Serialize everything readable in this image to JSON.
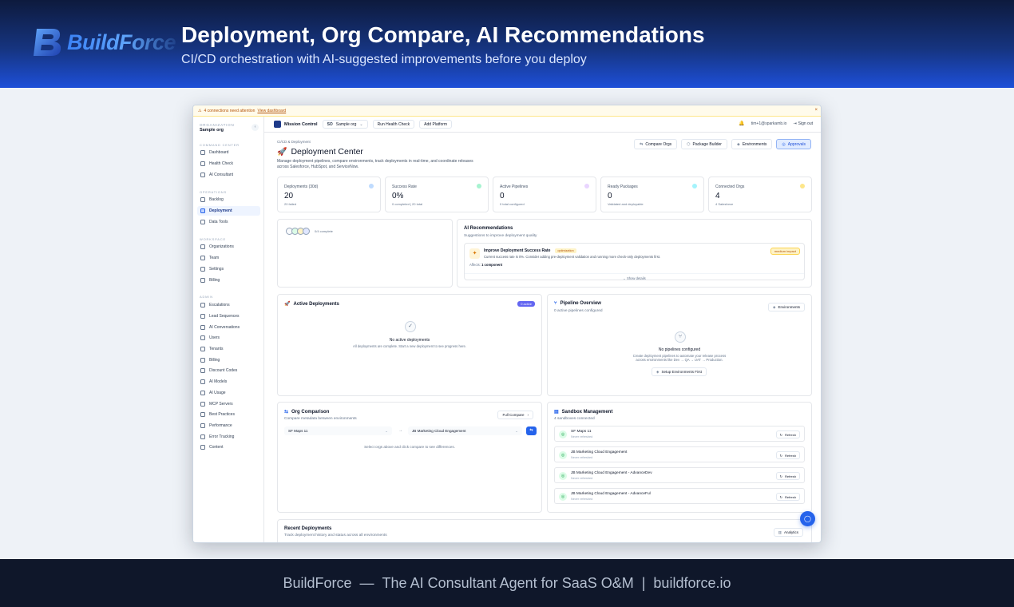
{
  "banner": {
    "logo_text": "BuildForce",
    "title": "Deployment, Org Compare, AI Recommendations",
    "subtitle": "CI/CD orchestration with AI-suggested improvements before you deploy"
  },
  "footer": {
    "brand": "BuildForce",
    "sep1": "—",
    "tagline": "The AI Consultant Agent for SaaS O&M",
    "sep2": "|",
    "site": "buildforce.io"
  },
  "warning": {
    "text": "4 connections need attention",
    "link": "View dashboard",
    "close": "×"
  },
  "sidebar": {
    "org_label": "ORGANIZATION",
    "org_value": "Sample org",
    "org_chevron": "‹",
    "sections": {
      "command": "COMMAND CENTER",
      "operations": "OPERATIONS",
      "workspace": "WORKSPACE",
      "admin": "ADMIN"
    },
    "command_items": [
      "Dashboard",
      "Health Check",
      "AI Consultant"
    ],
    "operations_items": [
      "Backlog",
      "Deployment",
      "Data Tools"
    ],
    "workspace_items": [
      "Organizations",
      "Team",
      "Settings",
      "Billing"
    ],
    "admin_items": [
      "Escalations",
      "Lead Sequences",
      "AI Conversations",
      "Users",
      "Tenants",
      "Billing",
      "Discount Codes",
      "AI Models",
      "AI Usage",
      "MCP Servers",
      "Best Practices",
      "Performance",
      "Error Tracking",
      "Content"
    ]
  },
  "topbar": {
    "title": "Mission Control",
    "org_initials": "SO",
    "org_name": "Sample org",
    "org_chevron": "⌄",
    "btn_health": "Run Health Check",
    "btn_platform": "Add Platform",
    "bell": "🔔",
    "email": "tim+1@sparkamb.io",
    "signout": "Sign out",
    "signout_icon": "⇥"
  },
  "page": {
    "breadcrumb": "CI/CD & Deployment",
    "title": "Deployment Center",
    "title_icon": "🚀",
    "description": "Manage deployment pipelines, compare environments, track deployments in real-time, and coordinate releases across Salesforce, HubSpot, and ServiceNow.",
    "actions": [
      {
        "icon": "⇆",
        "label": "Compare Orgs"
      },
      {
        "icon": "⬡",
        "label": "Package Builder"
      },
      {
        "icon": "◈",
        "label": "Environments"
      },
      {
        "icon": "◎",
        "label": "Approvals"
      }
    ]
  },
  "stats": [
    {
      "label": "Deployments (30d)",
      "value": "20",
      "sub": "20 failed",
      "color": "#3b82f6"
    },
    {
      "label": "Success Rate",
      "value": "0%",
      "sub": "0 completed | 20 total",
      "color": "#10b981"
    },
    {
      "label": "Active Pipelines",
      "value": "0",
      "sub": "0 total configured",
      "color": "#a855f7"
    },
    {
      "label": "Ready Packages",
      "value": "0",
      "sub": "Validated and deployable",
      "color": "#06b6d4"
    },
    {
      "label": "Connected Orgs",
      "value": "4",
      "sub": "4 Salesforce",
      "color": "#f59e0b"
    }
  ],
  "progress": {
    "text": "0/4 complete",
    "done": 0,
    "total": 4
  },
  "ai_recs": {
    "title": "AI Recommendations",
    "subtitle": "Suggestions to improve deployment quality",
    "item": {
      "icon": "✦",
      "title": "Improve Deployment Success Rate",
      "tag": "optimization",
      "desc": "Current success rate is 0%. Consider adding pre-deployment validation and running more check-only deployments first.",
      "badge": "medium impact",
      "affects_label": "Affects:",
      "affects_value": "1 component",
      "show_details": "⌄  Show details"
    }
  },
  "active_deployments": {
    "title": "Active Deployments",
    "icon": "🚀",
    "badge": "0 active",
    "empty_icon": "✓",
    "empty_title": "No active deployments",
    "empty_desc": "All deployments are complete. Start a new deployment to see progress here."
  },
  "pipeline": {
    "title": "Pipeline Overview",
    "icon": "⑂",
    "subtitle": "0 active pipelines configured",
    "btn_env": "Environments",
    "btn_env_icon": "◈",
    "empty_icon": "⑂",
    "empty_title": "No pipelines configured",
    "empty_desc1": "Create deployment pipelines to automate your release process",
    "empty_desc2": "across environments like Dev → QA → UAT → Production.",
    "setup_btn": "Setup Environments First",
    "setup_icon": "◈"
  },
  "org_compare": {
    "title": "Org Comparison",
    "icon": "⇆",
    "subtitle": "Compare metadata between environments",
    "full_btn": "Full Compare",
    "full_chev": "›",
    "source": "SF Maps 11",
    "target": "JB Marketing Cloud Engagement",
    "arrow": "→",
    "sel_chev": "⌄",
    "go_icon": "⇆",
    "hint": "Select orgs above and click compare to see differences."
  },
  "sandbox": {
    "title": "Sandbox Management",
    "icon": "▤",
    "subtitle": "4 sandboxes connected",
    "refresh": "Refresh",
    "refresh_icon": "↻",
    "status_icon": "◎",
    "items": [
      {
        "name": "SF Maps 11",
        "meta": "Never refreshed"
      },
      {
        "name": "JB Marketing Cloud Engagement",
        "meta": "Never refreshed"
      },
      {
        "name": "JB Marketing Cloud Engagement - AdvanceDev",
        "meta": "Never refreshed"
      },
      {
        "name": "JB Marketing Cloud Engagement - AdvanceFul",
        "meta": "Never refreshed"
      }
    ]
  },
  "recent": {
    "title": "Recent Deployments",
    "subtitle": "Track deployment history and status across all environments",
    "btn": "Analytics",
    "btn_icon": "▥"
  },
  "fab_icon": "◯",
  "colors": {
    "accent": "#2563eb",
    "banner_dark": "#0d1a3d",
    "banner_light": "#1d4fd8",
    "footer": "#0f172a"
  }
}
